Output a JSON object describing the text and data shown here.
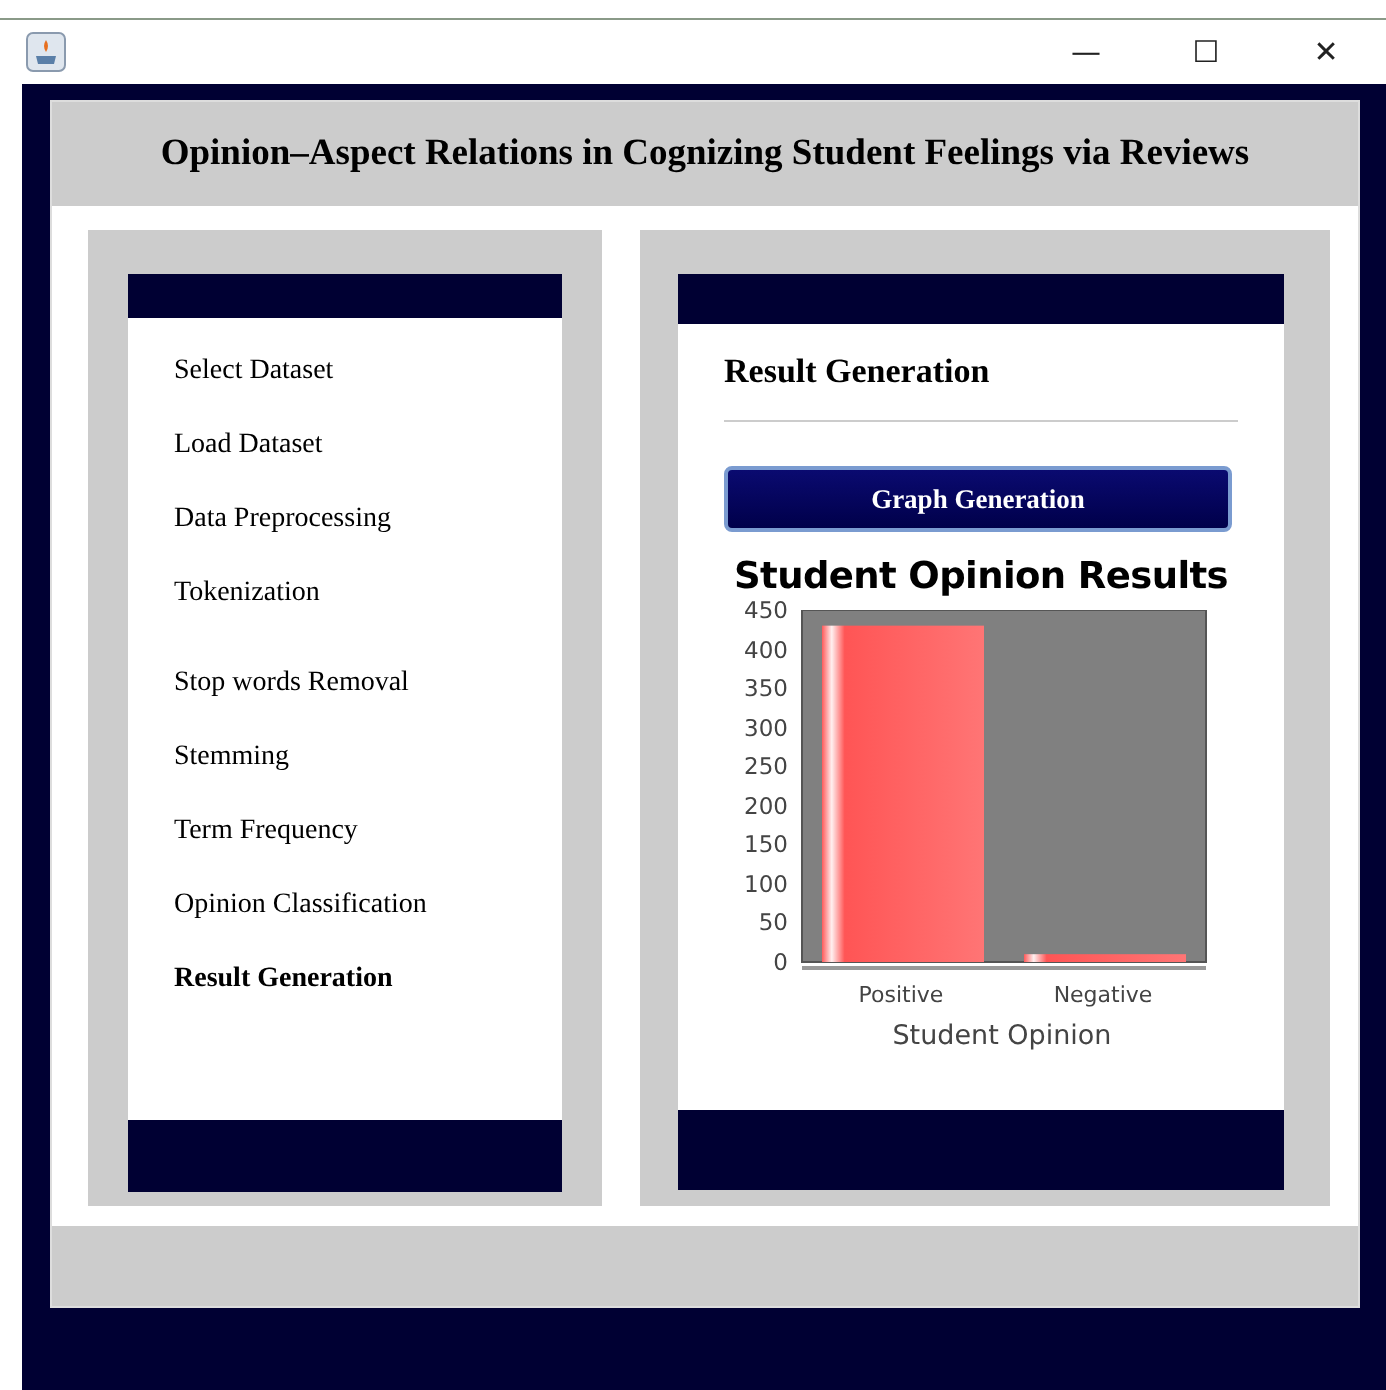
{
  "window": {
    "controls": [
      "—",
      "☐",
      "✕"
    ]
  },
  "header": {
    "title": "Opinion–Aspect Relations in Cognizing Student Feelings via Reviews"
  },
  "sidebar": {
    "items": [
      {
        "label": "Select Dataset",
        "selected": false
      },
      {
        "label": "Load Dataset",
        "selected": false
      },
      {
        "label": "Data Preprocessing",
        "selected": false
      },
      {
        "label": "Tokenization",
        "selected": false
      },
      {
        "label": "Stop words Removal",
        "selected": false
      },
      {
        "label": "Stemming",
        "selected": false
      },
      {
        "label": "Term Frequency",
        "selected": false
      },
      {
        "label": "Opinion Classification",
        "selected": false
      },
      {
        "label": "Result Generation",
        "selected": true
      }
    ]
  },
  "content": {
    "heading": "Result Generation",
    "button": "Graph Generation",
    "chart_data": {
      "type": "bar",
      "title": "Student Opinion Results",
      "xlabel": "Student Opinion",
      "categories": [
        "Positive",
        "Negative"
      ],
      "values": [
        430,
        10
      ],
      "ylim": [
        0,
        450
      ],
      "yticks": [
        0,
        50,
        100,
        150,
        200,
        250,
        300,
        350,
        400,
        450
      ]
    }
  }
}
